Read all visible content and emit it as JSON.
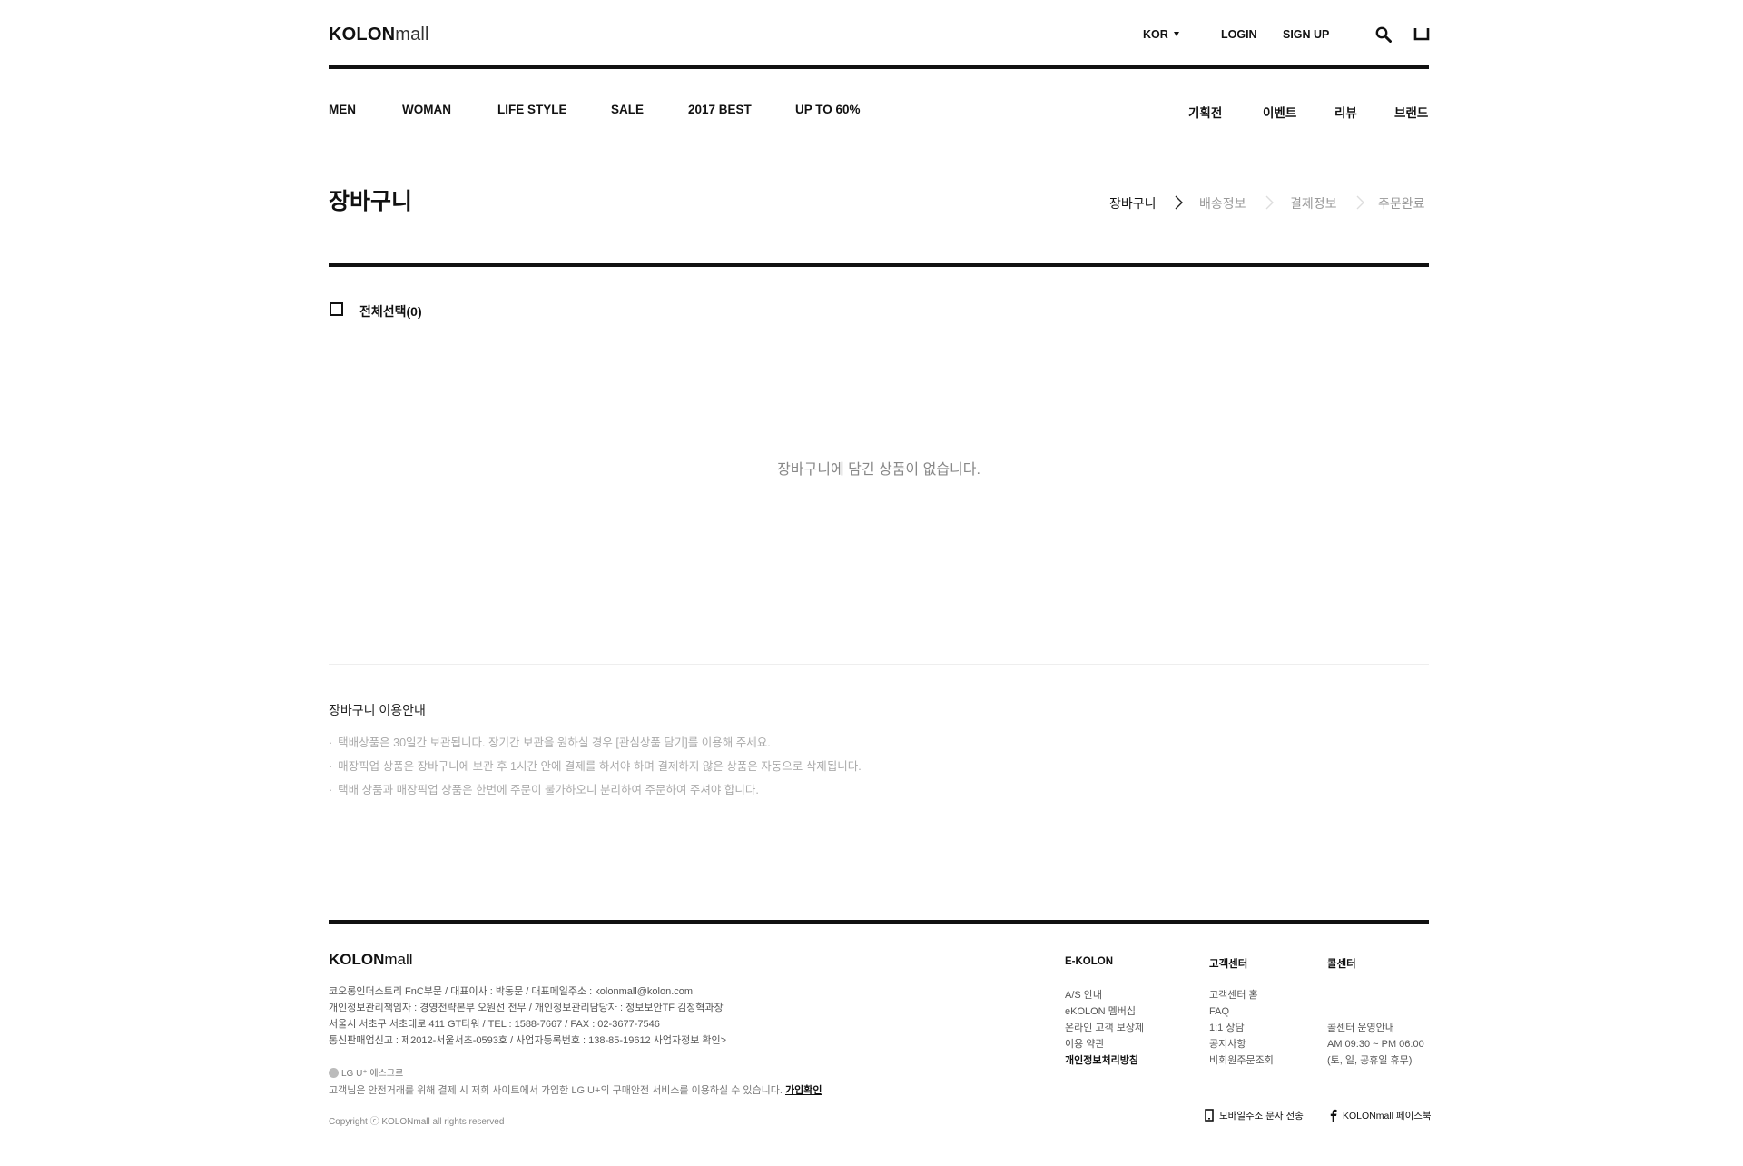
{
  "header": {
    "logo_bold": "KOLON",
    "logo_light": "mall",
    "lang": "KOR",
    "login": "LOGIN",
    "signup": "SIGN UP",
    "icons": [
      "search-icon",
      "shopping-bag-icon",
      "caret-down-icon"
    ]
  },
  "gnb": {
    "left": [
      "MEN",
      "WOMAN",
      "LIFE STYLE",
      "SALE",
      "2017 BEST",
      "UP TO 60%"
    ],
    "right": [
      "기획전",
      "이벤트",
      "리뷰",
      "브랜드"
    ]
  },
  "page": {
    "title": "장바구니",
    "steps": [
      "장바구니",
      "배송정보",
      "결제정보",
      "주문완료"
    ],
    "active_step": 0
  },
  "cart": {
    "select_all": "전체선택(0)",
    "empty_message": "장바구니에 담긴 상품이 없습니다."
  },
  "guide": {
    "title": "장바구니 이용안내",
    "items": [
      "택배상품은 30일간 보관됩니다. 장기간 보관을 원하실 경우 [관심상품 담기]를 이용해 주세요.",
      "매장픽업 상품은 장바구니에 보관 후 1시간 안에 결제를 하셔야 하며 결제하지 않은 상품은 자동으로 삭제됩니다.",
      "택배 상품과 매장픽업 상품은 한번에 주문이 불가하오니 분리하여 주문하여 주셔야 합니다."
    ]
  },
  "footer": {
    "logo_bold": "KOLON",
    "logo_light": "mall",
    "info": [
      "코오롱인더스트리 FnC부문 / 대표이사 : 박동문 / 대표메일주소 : kolonmall@kolon.com",
      "개인정보관리책임자 : 경영전략본부 오원선 전무 / 개인정보관리담당자 : 정보보안TF 김정혁과장",
      "서울시 서초구 서초대로 411 GT타워 / TEL : 1588-7667 / FAX : 02-3677-7546",
      "통신판매업신고 : 제2012-서울서초-0593호 / 사업자등록번호 : 138-85-19612  사업자정보 확인>"
    ],
    "escrow_label": "LG U⁺ 에스크로",
    "escrow_desc": "고객님은 안전거래를 위해 결제 시 저희 사이트에서 가입한 LG U+의 구매안전 서비스를 이용하실 수 있습니다.",
    "escrow_link": "가입확인",
    "copyright": "Copyright ⓒ KOLONmall all rights reserved",
    "col1": {
      "title": "E-KOLON",
      "items": [
        "A/S 안내",
        "eKOLON 멤버십",
        "온라인 고객 보상제",
        "이용 약관",
        "개인정보처리방침"
      ]
    },
    "col2": {
      "title": "고객센터",
      "items": [
        "고객센터 홈",
        "FAQ",
        "1:1 상담",
        "공지사항",
        "비회원주문조회"
      ]
    },
    "col3": {
      "title": "콜센터",
      "items": [
        "콜센터 운영안내",
        "AM 09:30 ~ PM 06:00",
        "(토, 일, 공휴일 휴무)"
      ]
    },
    "mobile_link": "모바일주소 문자 전송",
    "facebook_link": "KOLONmall 페이스북"
  }
}
